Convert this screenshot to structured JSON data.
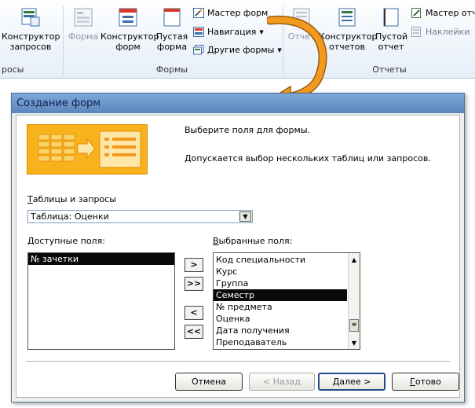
{
  "ribbon": {
    "query_designer": {
      "line1": "Конструктор",
      "line2": "запросов"
    },
    "queries_group_label": "росы",
    "form": {
      "label": "Форма"
    },
    "form_designer": {
      "line1": "Конструктор",
      "line2": "форм"
    },
    "blank_form": {
      "line1": "Пустая",
      "line2": "форма"
    },
    "form_wizard": "Мастер форм",
    "navigation": "Навигация",
    "other_forms": "Другие формы",
    "forms_group_label": "Формы",
    "report": {
      "label": "Отчет"
    },
    "report_designer": {
      "line1": "Конструктор",
      "line2": "отчетов"
    },
    "blank_report": {
      "line1": "Пустой",
      "line2": "отчет"
    },
    "report_wizard": "Мастер отче",
    "labels": "Наклейки",
    "reports_group_label": "Отчеты"
  },
  "dialog": {
    "title": "Создание форм",
    "instruction": "Выберите поля для формы.",
    "hint": "Допускается выбор нескольких таблиц или запросов.",
    "tables_label": "Таблицы и запросы",
    "tables_label_accel": "Т",
    "tables_label_rest": "аблицы и запросы",
    "tables_value": "Таблица: Оценки",
    "available_label_accel": "Д",
    "available_label_rest": "оступные поля:",
    "selected_label_accel": "В",
    "selected_label_rest": "ыбранные поля:",
    "available_fields": [
      "№ зачетки"
    ],
    "available_selected_index": 0,
    "selected_fields": [
      "Код специальности",
      "Курс",
      "Группа",
      "Семестр",
      "№ предмета",
      "Оценка",
      "Дата получения",
      "Преподаватель"
    ],
    "selected_highlight_index": 3,
    "move_buttons": {
      "add": ">",
      "add_all": ">>",
      "remove": "<",
      "remove_all": "<<"
    },
    "buttons": {
      "cancel": "Отмена",
      "back": "< Назад",
      "next_accel": "Д",
      "next_rest": "алее >",
      "finish_accel": "Г",
      "finish_rest": "отово"
    }
  },
  "colors": {
    "title_bar": "#5a86bd",
    "wizard_image": "#f7b21c",
    "arrow": "#f39a1e"
  }
}
